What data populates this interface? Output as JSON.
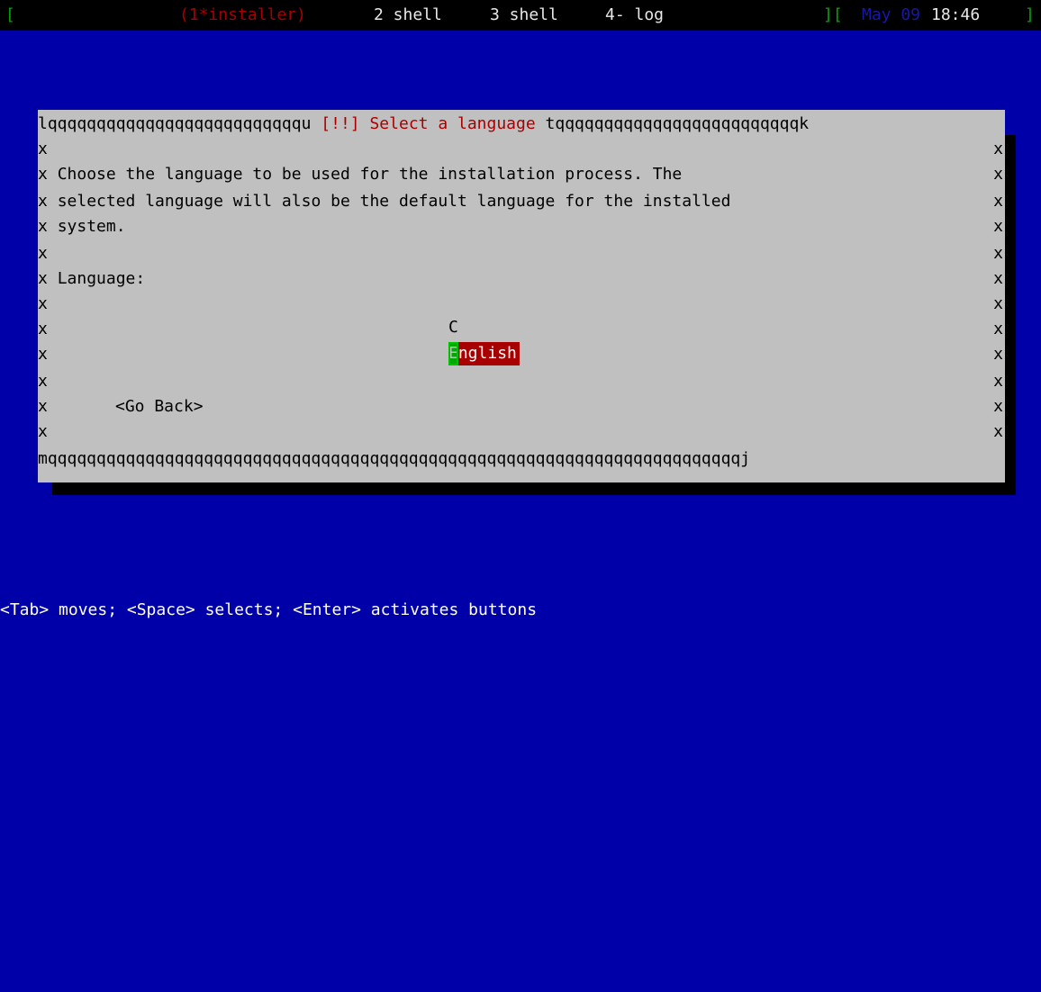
{
  "statusbar": {
    "left_bracket": "[",
    "win1": "(1*installer)",
    "win2": "2 shell",
    "win3": "3 shell",
    "win4": "4- log",
    "sep": "][",
    "date": "May 09",
    "time": "18:46",
    "right_bracket": "]"
  },
  "dialog": {
    "top_border_left": "lqqqqqqqqqqqqqqqqqqqqqqqqqqu ",
    "title": "[!!] Select a language",
    "top_border_right": " tqqqqqqqqqqqqqqqqqqqqqqqqqk",
    "border_char": "x",
    "description_lines": [
      "Choose the language to be used for the installation process. The",
      "selected language will also be the default language for the installed",
      "system."
    ],
    "language_label": "Language:",
    "options": [
      "C",
      "English"
    ],
    "selected_cursor_char": "E",
    "selected_rest": "nglish",
    "go_back_label": "<Go Back>",
    "bottom_border": "mqqqqqqqqqqqqqqqqqqqqqqqqqqqqqqqqqqqqqqqqqqqqqqqqqqqqqqqqqqqqqqqqqqqqqqqj"
  },
  "hint": "<Tab> moves; <Space> selects; <Enter> activates buttons"
}
